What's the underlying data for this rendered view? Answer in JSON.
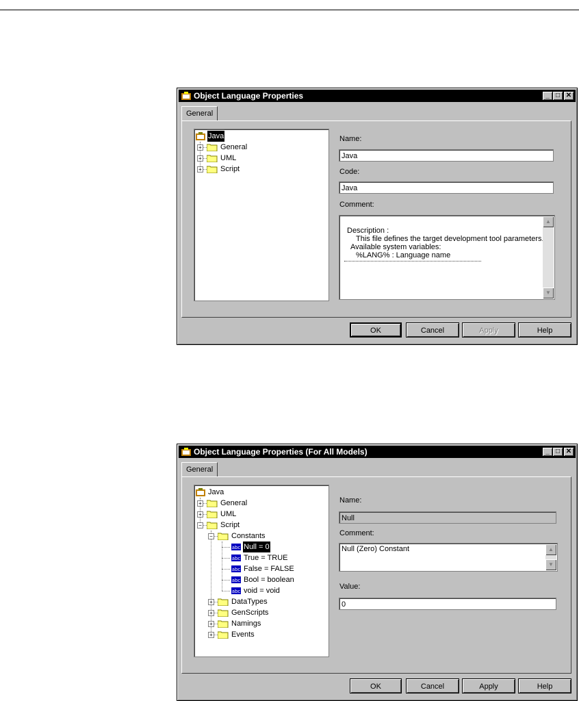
{
  "colors": {
    "titlebar": "#000000",
    "dialog": "#c0c0c0",
    "selection": "#000000"
  },
  "dialog1": {
    "title": "Object Language Properties",
    "tab": "General",
    "tree": [
      {
        "label": "Java",
        "icon": "model-icon",
        "selected": true
      },
      {
        "label": "General",
        "icon": "folder-icon",
        "expander": "+"
      },
      {
        "label": "UML",
        "icon": "folder-icon",
        "expander": "+"
      },
      {
        "label": "Script",
        "icon": "folder-icon",
        "expander": "+"
      }
    ],
    "name_label": "Name:",
    "name_value": "Java",
    "code_label": "Code:",
    "code_value": "Java",
    "comment_label": "Comment:",
    "comment_lines": [
      "Description :",
      "This file defines the target development tool parameters.",
      "Available system variables:",
      "%LANG%  : Language name"
    ],
    "buttons": {
      "ok": "OK",
      "cancel": "Cancel",
      "apply": "Apply",
      "help": "Help"
    }
  },
  "dialog2": {
    "title": "Object Language Properties (For All Models)",
    "tab": "General",
    "tree": [
      {
        "label": "Java",
        "icon": "model-icon"
      },
      {
        "label": "General",
        "icon": "folder-icon",
        "expander": "+"
      },
      {
        "label": "UML",
        "icon": "folder-icon",
        "expander": "+"
      },
      {
        "label": "Script",
        "icon": "folder-icon",
        "expander": "-"
      },
      {
        "label": "Constants",
        "icon": "folder-icon",
        "expander": "-"
      },
      {
        "label": "Null = 0",
        "icon": "abc-icon",
        "selected": true
      },
      {
        "label": "True = TRUE",
        "icon": "abc-icon"
      },
      {
        "label": "False = FALSE",
        "icon": "abc-icon"
      },
      {
        "label": "Bool = boolean",
        "icon": "abc-icon"
      },
      {
        "label": "void = void",
        "icon": "abc-icon"
      },
      {
        "label": "DataTypes",
        "icon": "folder-icon",
        "expander": "+"
      },
      {
        "label": "GenScripts",
        "icon": "folder-icon",
        "expander": "+"
      },
      {
        "label": "Namings",
        "icon": "folder-icon",
        "expander": "+"
      },
      {
        "label": "Events",
        "icon": "folder-icon",
        "expander": "+"
      }
    ],
    "name_label": "Name:",
    "name_value": "Null",
    "comment_label": "Comment:",
    "comment_value": "Null (Zero) Constant",
    "value_label": "Value:",
    "value_value": "0",
    "buttons": {
      "ok": "OK",
      "cancel": "Cancel",
      "apply": "Apply",
      "help": "Help"
    }
  }
}
